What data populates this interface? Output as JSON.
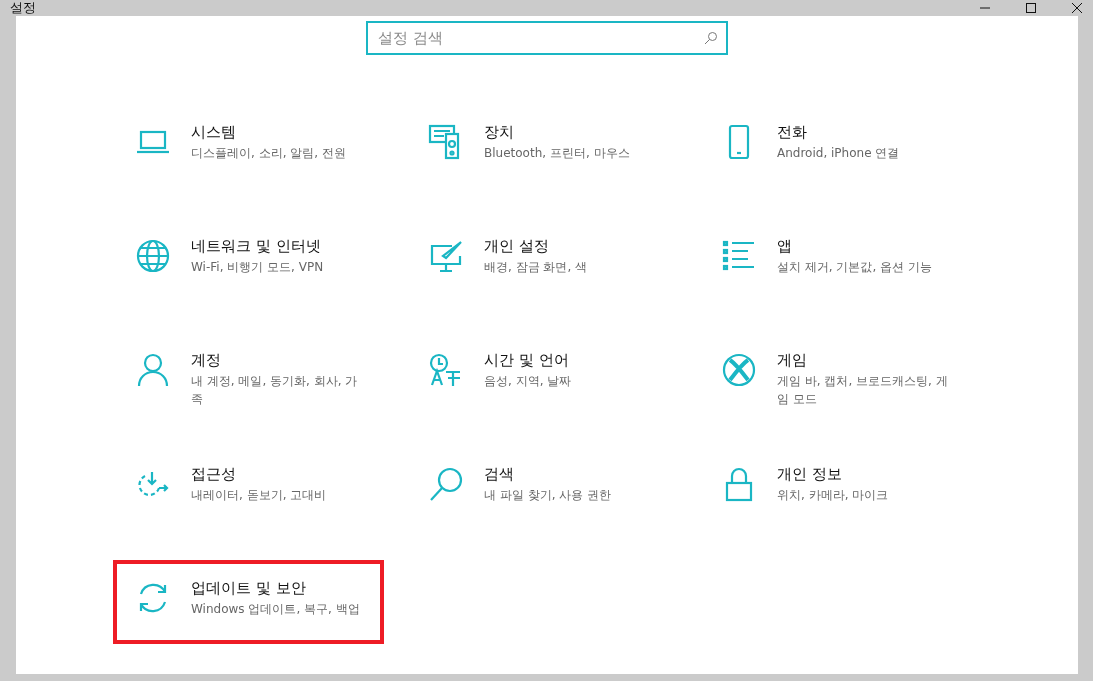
{
  "window": {
    "title": "설정"
  },
  "search": {
    "placeholder": "설정 검색"
  },
  "items": [
    {
      "title": "시스템",
      "description": "디스플레이, 소리, 알림, 전원",
      "highlighted": false
    },
    {
      "title": "장치",
      "description": "Bluetooth, 프린터, 마우스",
      "highlighted": false
    },
    {
      "title": "전화",
      "description": "Android, iPhone 연결",
      "highlighted": false
    },
    {
      "title": "네트워크 및 인터넷",
      "description": "Wi-Fi, 비행기 모드, VPN",
      "highlighted": false
    },
    {
      "title": "개인 설정",
      "description": "배경, 잠금 화면, 색",
      "highlighted": false
    },
    {
      "title": "앱",
      "description": "설치 제거, 기본값, 옵션 기능",
      "highlighted": false
    },
    {
      "title": "계정",
      "description": "내 계정, 메일, 동기화, 회사, 가족",
      "highlighted": false
    },
    {
      "title": "시간 및 언어",
      "description": "음성, 지역, 날짜",
      "highlighted": false
    },
    {
      "title": "게임",
      "description": "게임 바, 캡처, 브로드캐스팅, 게임 모드",
      "highlighted": false
    },
    {
      "title": "접근성",
      "description": "내레이터, 돋보기, 고대비",
      "highlighted": false
    },
    {
      "title": "검색",
      "description": "내 파일 찾기, 사용 권한",
      "highlighted": false
    },
    {
      "title": "개인 정보",
      "description": "위치, 카메라, 마이크",
      "highlighted": false
    },
    {
      "title": "업데이트 및 보안",
      "description": "Windows 업데이트, 복구, 백업",
      "highlighted": true
    }
  ]
}
